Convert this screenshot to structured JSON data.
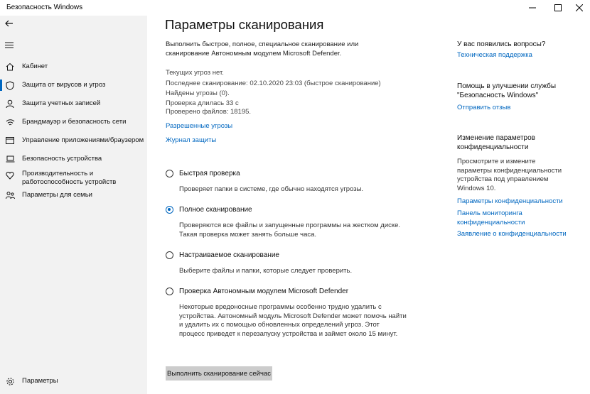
{
  "window": {
    "title": "Безопасность Windows",
    "minimize": "—",
    "maximize": "☐",
    "close": "✕"
  },
  "sidebar": {
    "items": [
      {
        "label": "Кабинет",
        "icon": "home-icon"
      },
      {
        "label": "Защита от вирусов и угроз",
        "icon": "shield-icon"
      },
      {
        "label": "Защита учетных записей",
        "icon": "person-icon"
      },
      {
        "label": "Брандмауэр и безопасность сети",
        "icon": "wifi-icon"
      },
      {
        "label": "Управление приложениями/браузером",
        "icon": "app-browser-icon"
      },
      {
        "label": "Безопасность устройства",
        "icon": "laptop-icon"
      },
      {
        "label": "Производительность и работоспособность устройств",
        "icon": "heart-icon"
      },
      {
        "label": "Параметры для семьи",
        "icon": "family-icon"
      }
    ],
    "settings_label": "Параметры"
  },
  "main": {
    "title": "Параметры сканирования",
    "subtitle": "Выполнить быстрое, полное, специальное сканирование или сканирование Автономным модулем Microsoft Defender.",
    "status": [
      "Текущих угроз нет.",
      "Последнее сканирование: 02.10.2020 23:03 (быстрое сканирование)",
      "Найдены угрозы (0).",
      "Проверка длилась 33 с",
      "Проверено файлов: 18195."
    ],
    "allowed_threats_link": "Разрешенные угрозы",
    "protection_history_link": "Журнал защиты",
    "scan_options": [
      {
        "label": "Быстрая проверка",
        "description": "Проверяет папки в системе, где обычно находятся угрозы.",
        "checked": false
      },
      {
        "label": "Полное сканирование",
        "description": "Проверяются все файлы и запущенные программы на жестком диске. Такая проверка может занять больше часа.",
        "checked": true
      },
      {
        "label": "Настраиваемое сканирование",
        "description": "Выберите файлы и папки, которые следует проверить.",
        "checked": false
      },
      {
        "label": "Проверка Автономным модулем Microsoft Defender",
        "description": "Некоторые вредоносные программы особенно трудно удалить с устройства. Автономный модуль Microsoft Defender может помочь найти и удалить их с помощью обновленных определений угроз. Этот процесс приведет к перезапуску устройства и займет около 15 минут.",
        "checked": false
      }
    ],
    "scan_button": "Выполнить сканирование сейчас"
  },
  "right_panel": {
    "questions_heading": "У вас появились вопросы?",
    "support_link": "Техническая поддержка",
    "improve_heading": "Помощь в улучшении службы \"Безопасность Windows\"",
    "feedback_link": "Отправить отзыв",
    "privacy_heading": "Изменение параметров конфиденциальности",
    "privacy_text": "Просмотрите и измените параметры конфиденциальности устройства под управлением Windows 10.",
    "privacy_settings_link": "Параметры конфиденциальности",
    "privacy_dashboard_link": "Панель мониторинга конфиденциальности",
    "privacy_statement_link": "Заявление о конфиденциальности"
  },
  "colors": {
    "accent": "#0067c0",
    "sidebar_bg": "#f2f2f2",
    "button_bg": "#cccccc"
  }
}
